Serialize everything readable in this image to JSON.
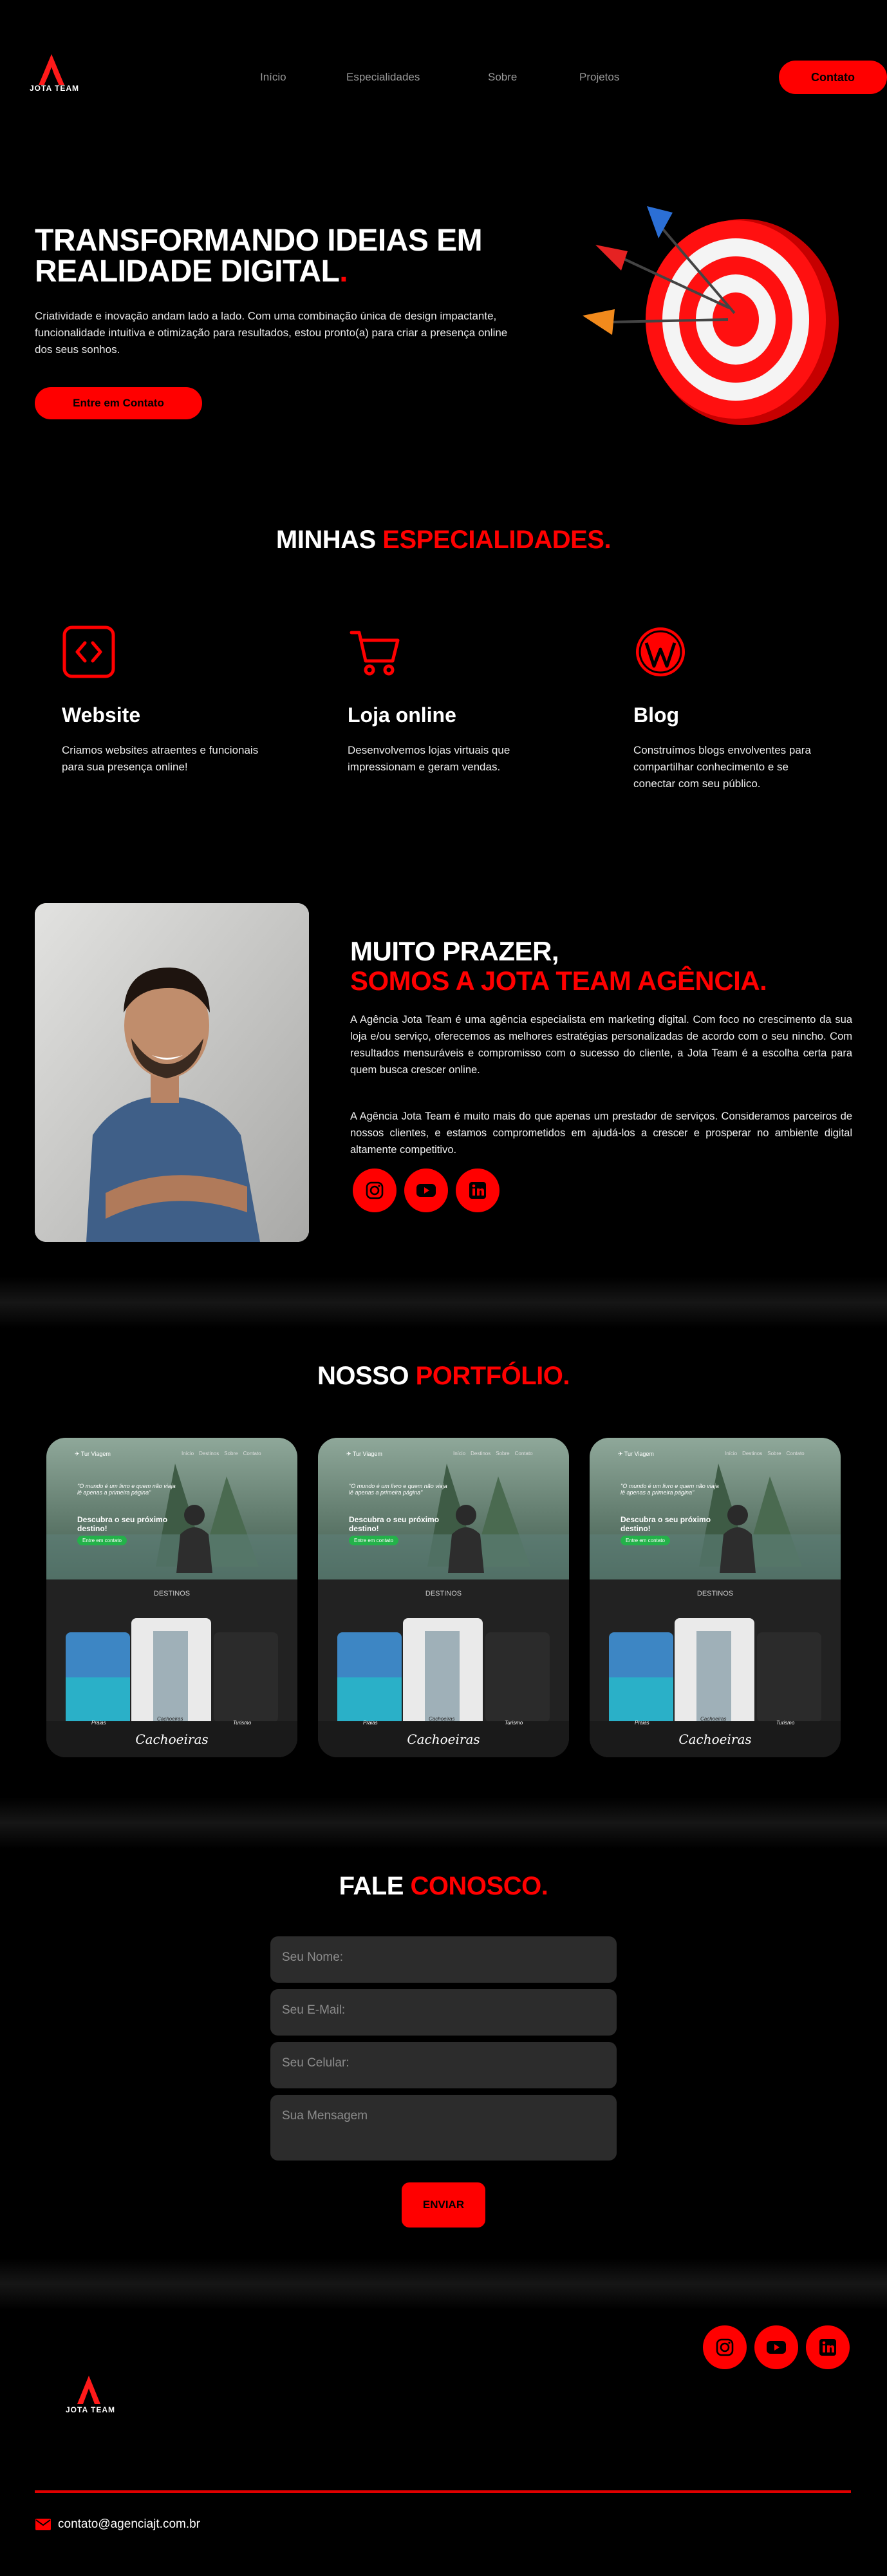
{
  "nav": {
    "logo_text": "JOTA TEAM",
    "links": [
      "Início",
      "Especialidades",
      "Sobre",
      "Projetos"
    ],
    "cta": "Contato"
  },
  "hero": {
    "title_line1": "TRANSFORMANDO IDEIAS EM",
    "title_line2": "REALIDADE DIGITAL",
    "title_dot": ".",
    "text": "Criatividade e inovação andam lado a lado. Com uma combinação única de design impactante, funcionalidade intuitiva e otimização para resultados, estou pronto(a) para criar a presença online dos seus sonhos.",
    "cta": "Entre em Contato"
  },
  "specialties": {
    "title_white": "MINHAS ",
    "title_red": "ESPECIALIDADES.",
    "items": [
      {
        "icon": "code-icon",
        "name": "Website",
        "desc": "Criamos websites atraentes e funcionais para sua presença online!"
      },
      {
        "icon": "cart-icon",
        "name": "Loja online",
        "desc": "Desenvolvemos lojas virtuais que impressionam e geram vendas."
      },
      {
        "icon": "wordpress-icon",
        "name": "Blog",
        "desc": "Construímos blogs envolventes para compartilhar conhecimento e se conectar com seu público."
      }
    ]
  },
  "about": {
    "title_line1": "MUITO PRAZER,",
    "title_line2": "SOMOS A JOTA TEAM AGÊNCIA.",
    "p1": "A Agência Jota Team é uma agência especialista em marketing digital. Com foco no crescimento da sua loja e/ou serviço, oferecemos as melhores estratégias personalizadas de acordo com o seu nincho. Com resultados mensuráveis e compromisso com o sucesso do cliente, a Jota Team é a escolha certa para quem busca crescer online.",
    "p2": "A Agência Jota Team é muito mais do que apenas um prestador de serviços. Consideramos parceiros de nossos clientes, e estamos comprometidos em ajudá-los a crescer e prosperar no ambiente digital altamente competitivo."
  },
  "portfolio": {
    "title_white": "NOSSO ",
    "title_red": "PORTFÓLIO.",
    "card": {
      "brand": "Tur Viagem",
      "menu": [
        "Início",
        "Destinos",
        "Sobre",
        "Contato"
      ],
      "quote": "\"O mundo é um livro e quem não viaja lê apenas a primeira página\"",
      "heading": "Descubra o seu próximo destino!",
      "button": "Entre em contato",
      "section": "DESTINOS",
      "labels": [
        "Praias",
        "Cachoeiras",
        "Turismo"
      ],
      "caption": "Cachoeiras"
    }
  },
  "contact": {
    "title_white": "FALE ",
    "title_red": "CONOSCO.",
    "fields": [
      "Seu Nome:",
      "Seu E-Mail:",
      "Seu Celular:",
      "Sua Mensagem"
    ],
    "submit": "ENVIAR"
  },
  "footer": {
    "logo_text": "JOTA TEAM",
    "email": "contato@agenciajt.com.br"
  },
  "colors": {
    "accent": "#ff0000",
    "background": "#000000",
    "field": "#2c2c2c"
  }
}
